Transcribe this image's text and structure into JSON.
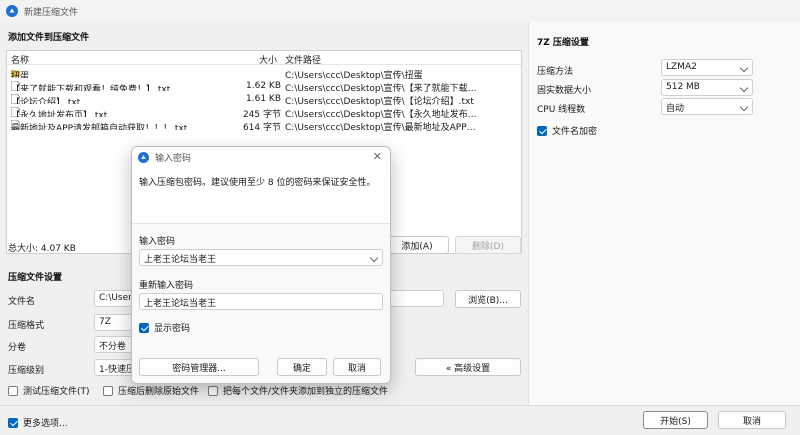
{
  "window": {
    "title": "新建压缩文件"
  },
  "files_section": {
    "title": "添加文件到压缩文件",
    "columns": {
      "name": "名称",
      "size": "大小",
      "path": "文件路径"
    },
    "rows": [
      {
        "type": "folder",
        "name": "扭蛋",
        "size": "",
        "path": "C:\\Users\\ccc\\Desktop\\宣传\\扭蛋"
      },
      {
        "type": "file",
        "name": "【来了就能下载和观看！纯免费！】.txt",
        "size": "1.62 KB",
        "path": "C:\\Users\\ccc\\Desktop\\宣传\\【来了就能下载和..."
      },
      {
        "type": "file",
        "name": "【论坛介绍】.txt",
        "size": "1.61 KB",
        "path": "C:\\Users\\ccc\\Desktop\\宣传\\【论坛介绍】.txt"
      },
      {
        "type": "file",
        "name": "【永久地址发布页】.txt",
        "size": "245 字节",
        "path": "C:\\Users\\ccc\\Desktop\\宣传\\【永久地址发布页..."
      },
      {
        "type": "file",
        "name": "最新地址及APP请发邮箱自动获取！！！.txt",
        "size": "614 字节",
        "path": "C:\\Users\\ccc\\Desktop\\宣传\\最新地址及APP请..."
      }
    ],
    "total_size": "总大小: 4.07 KB",
    "add_button": "添加(A)",
    "delete_button": "删除(D)"
  },
  "archive_settings": {
    "title": "压缩文件设置",
    "filename_label": "文件名",
    "filename_value": "C:\\Users",
    "browse_button": "浏览(B)...",
    "format_label": "压缩格式",
    "format_value": "7Z",
    "split_label": "分卷",
    "split_value": "不分卷",
    "level_label": "压缩级别",
    "level_value": "1-快速压",
    "advanced_button": "« 高级设置",
    "options": [
      {
        "label": "测试压缩文件(T)",
        "checked": false
      },
      {
        "label": "压缩后删除原始文件",
        "checked": false
      },
      {
        "label": "把每个文件/文件夹添加到独立的压缩文件",
        "checked": false
      }
    ]
  },
  "seven_zip_settings": {
    "title": "7Z 压缩设置",
    "method_label": "压缩方法",
    "method_value": "LZMA2",
    "dict_label": "固实数据大小",
    "dict_value": "512 MB",
    "threads_label": "CPU 线程数",
    "threads_value": "自动",
    "encrypt_names": {
      "label": "文件名加密",
      "checked": true
    }
  },
  "footer": {
    "more_options": {
      "label": "更多选项...",
      "checked": true
    },
    "start_button": "开始(S)",
    "cancel_button": "取消"
  },
  "password_dialog": {
    "title": "输入密码",
    "description": "输入压缩包密码。建议使用至少 8 位的密码来保证安全性。",
    "password_label": "输入密码",
    "password_value": "上老王论坛当老王",
    "confirm_label": "重新输入密码",
    "confirm_value": "上老王论坛当老王",
    "show_password": {
      "label": "显示密码",
      "checked": true
    },
    "manager_button": "密码管理器...",
    "ok_button": "确定",
    "cancel_button": "取消"
  },
  "colors": {
    "accent": "#0067c0",
    "folder": "#e8b84a"
  }
}
